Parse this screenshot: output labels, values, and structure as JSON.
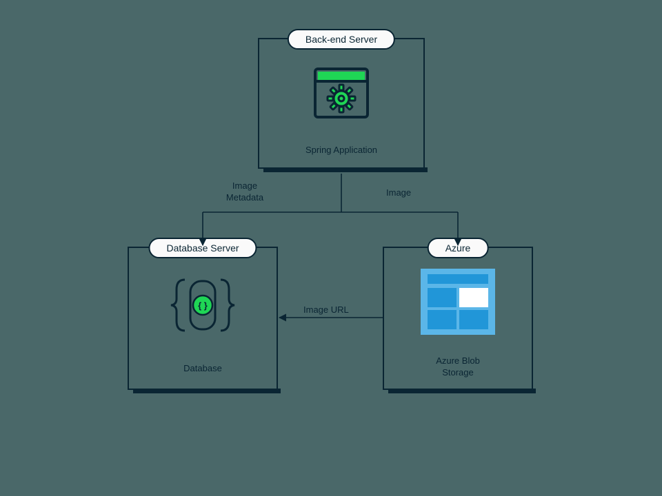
{
  "nodes": {
    "backend": {
      "title": "Back-end Server",
      "caption": "Spring Application"
    },
    "db": {
      "title": "Database Server",
      "caption": "Database"
    },
    "azure": {
      "title": "Azure",
      "caption": "Azure Blob Storage"
    }
  },
  "edges": {
    "backend_to_db": "Image Metadata",
    "backend_to_azure": "Image",
    "azure_to_db": "Image URL"
  },
  "icons": {
    "spring": "spring-app-icon",
    "database": "database-icon",
    "blob": "azure-blob-icon"
  },
  "colors": {
    "stroke": "#0a2533",
    "green": "#1fd655",
    "greenDark": "#0a2533",
    "azureBlue": "#2196d8",
    "azureLight": "#5bb6e8",
    "white": "#ffffff"
  }
}
